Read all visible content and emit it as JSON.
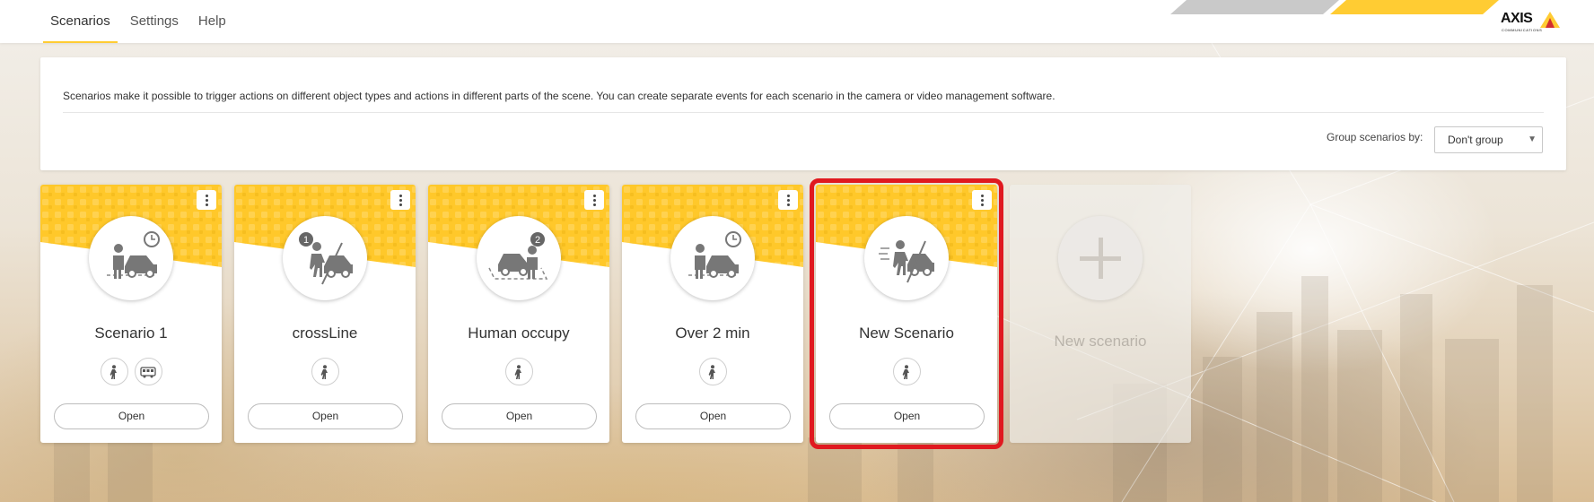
{
  "nav": {
    "tabs": [
      {
        "label": "Scenarios",
        "active": true
      },
      {
        "label": "Settings",
        "active": false
      },
      {
        "label": "Help",
        "active": false
      }
    ]
  },
  "brand": {
    "logo_text": "AXIS",
    "logo_sub": "COMMUNICATIONS",
    "accent_color": "#ffcc33"
  },
  "info": {
    "description": "Scenarios make it possible to trigger actions on different object types and actions in different parts of the scene. You can create separate events for each scenario in the camera or video management software.",
    "group_label": "Group scenarios by:",
    "group_value": "Don't group"
  },
  "scenarios": [
    {
      "title": "Scenario 1",
      "icon": "area-time-icon",
      "objects": [
        "human-icon",
        "bus-icon"
      ],
      "open_label": "Open"
    },
    {
      "title": "crossLine",
      "icon": "crossline-1-icon",
      "objects": [
        "human-icon"
      ],
      "open_label": "Open"
    },
    {
      "title": "Human occupy",
      "icon": "occupancy-2-icon",
      "objects": [
        "human-icon"
      ],
      "open_label": "Open"
    },
    {
      "title": "Over 2 min",
      "icon": "area-time-icon",
      "objects": [
        "human-icon"
      ],
      "open_label": "Open"
    },
    {
      "title": "New Scenario",
      "icon": "motion-crossline-icon",
      "objects": [
        "human-icon"
      ],
      "open_label": "Open",
      "highlighted": true
    }
  ],
  "new_scenario": {
    "label": "New scenario"
  },
  "highlight_color": "#e0191f"
}
